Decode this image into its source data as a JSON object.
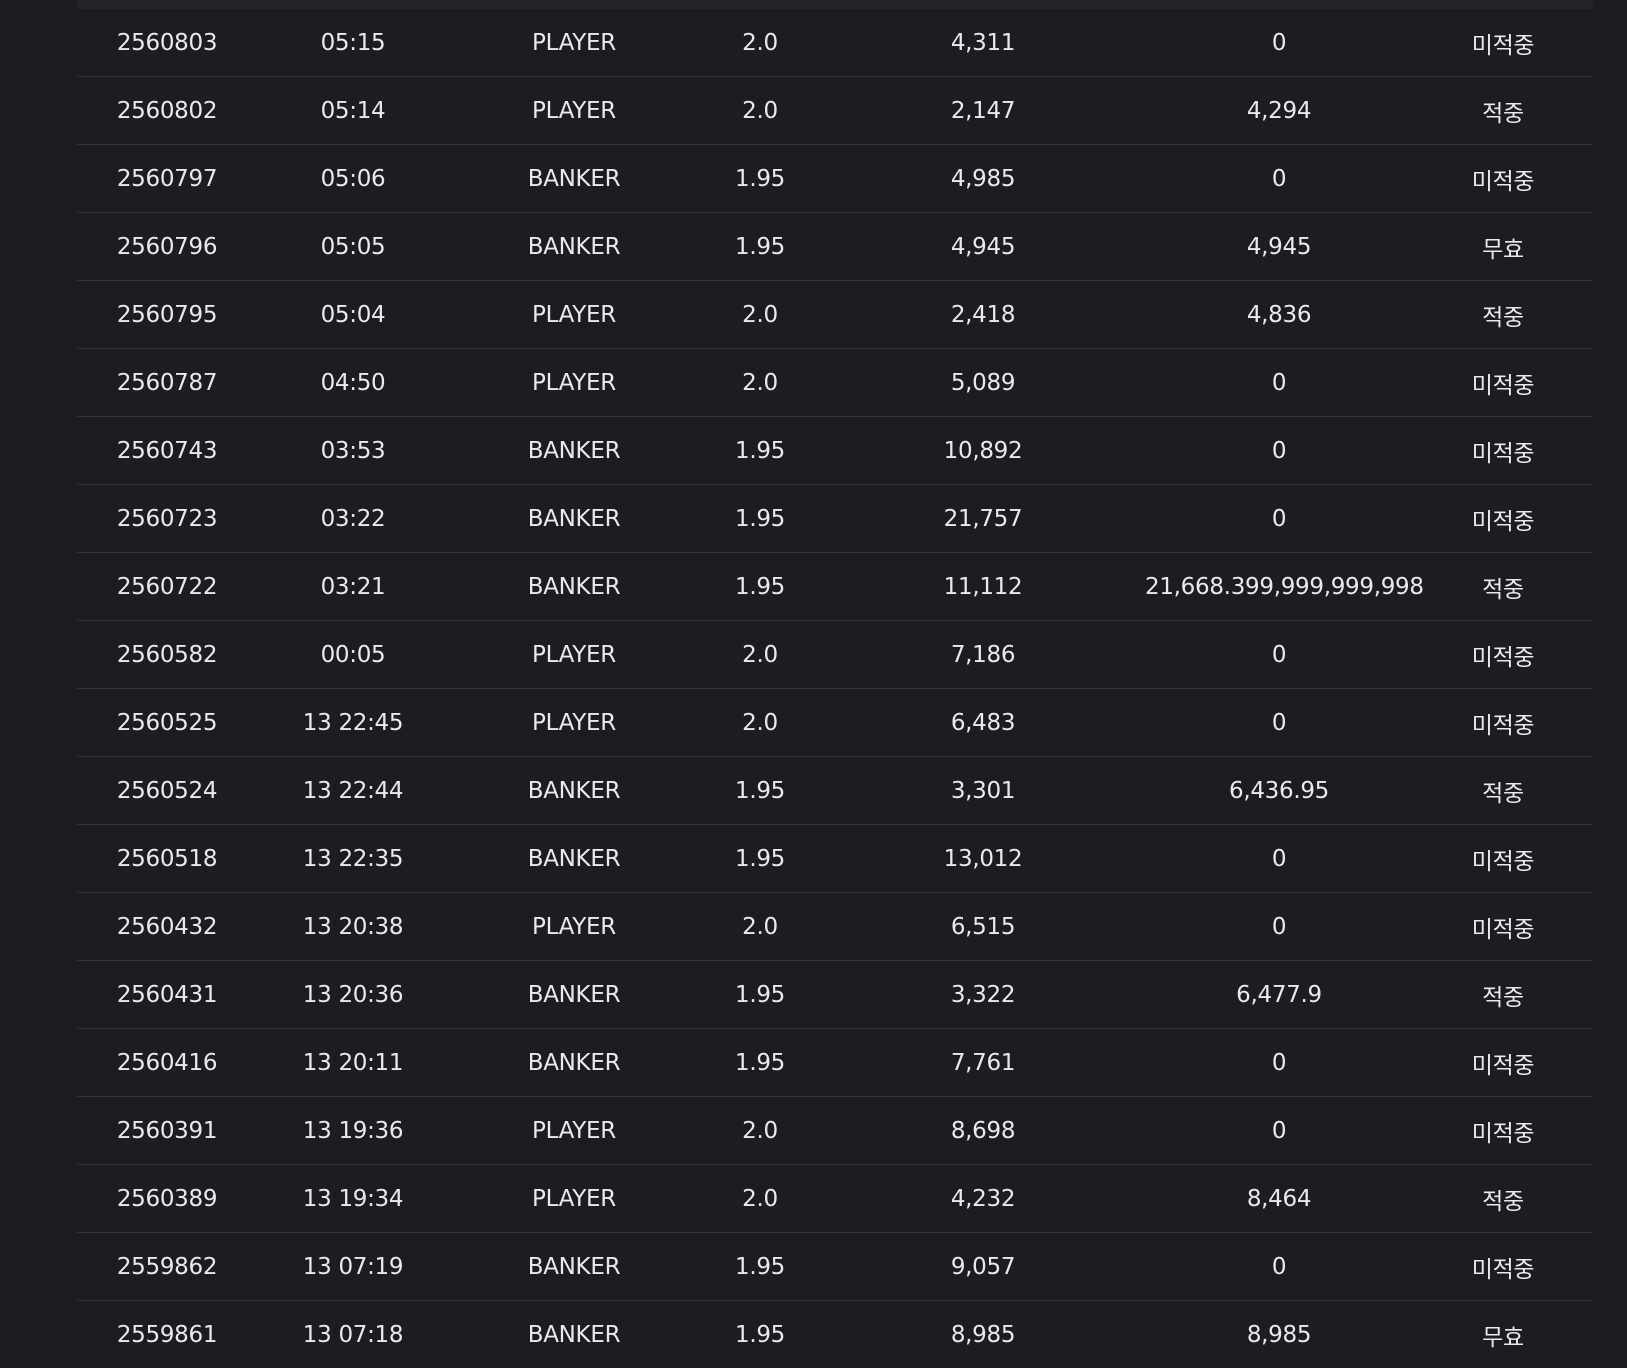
{
  "bet_history": {
    "rows": [
      {
        "id": "2560803",
        "time": "05:15",
        "pick": "PLAYER",
        "odds": "2.0",
        "bet": "4,311",
        "win": "0",
        "result": "미적중"
      },
      {
        "id": "2560802",
        "time": "05:14",
        "pick": "PLAYER",
        "odds": "2.0",
        "bet": "2,147",
        "win": "4,294",
        "result": "적중"
      },
      {
        "id": "2560797",
        "time": "05:06",
        "pick": "BANKER",
        "odds": "1.95",
        "bet": "4,985",
        "win": "0",
        "result": "미적중"
      },
      {
        "id": "2560796",
        "time": "05:05",
        "pick": "BANKER",
        "odds": "1.95",
        "bet": "4,945",
        "win": "4,945",
        "result": "무효"
      },
      {
        "id": "2560795",
        "time": "05:04",
        "pick": "PLAYER",
        "odds": "2.0",
        "bet": "2,418",
        "win": "4,836",
        "result": "적중"
      },
      {
        "id": "2560787",
        "time": "04:50",
        "pick": "PLAYER",
        "odds": "2.0",
        "bet": "5,089",
        "win": "0",
        "result": "미적중"
      },
      {
        "id": "2560743",
        "time": "03:53",
        "pick": "BANKER",
        "odds": "1.95",
        "bet": "10,892",
        "win": "0",
        "result": "미적중"
      },
      {
        "id": "2560723",
        "time": "03:22",
        "pick": "BANKER",
        "odds": "1.95",
        "bet": "21,757",
        "win": "0",
        "result": "미적중"
      },
      {
        "id": "2560722",
        "time": "03:21",
        "pick": "BANKER",
        "odds": "1.95",
        "bet": "11,112",
        "win": "21,668.399,999,999,998",
        "result": "적중"
      },
      {
        "id": "2560582",
        "time": "00:05",
        "pick": "PLAYER",
        "odds": "2.0",
        "bet": "7,186",
        "win": "0",
        "result": "미적중"
      },
      {
        "id": "2560525",
        "time": "13 22:45",
        "pick": "PLAYER",
        "odds": "2.0",
        "bet": "6,483",
        "win": "0",
        "result": "미적중"
      },
      {
        "id": "2560524",
        "time": "13 22:44",
        "pick": "BANKER",
        "odds": "1.95",
        "bet": "3,301",
        "win": "6,436.95",
        "result": "적중"
      },
      {
        "id": "2560518",
        "time": "13 22:35",
        "pick": "BANKER",
        "odds": "1.95",
        "bet": "13,012",
        "win": "0",
        "result": "미적중"
      },
      {
        "id": "2560432",
        "time": "13 20:38",
        "pick": "PLAYER",
        "odds": "2.0",
        "bet": "6,515",
        "win": "0",
        "result": "미적중"
      },
      {
        "id": "2560431",
        "time": "13 20:36",
        "pick": "BANKER",
        "odds": "1.95",
        "bet": "3,322",
        "win": "6,477.9",
        "result": "적중"
      },
      {
        "id": "2560416",
        "time": "13 20:11",
        "pick": "BANKER",
        "odds": "1.95",
        "bet": "7,761",
        "win": "0",
        "result": "미적중"
      },
      {
        "id": "2560391",
        "time": "13 19:36",
        "pick": "PLAYER",
        "odds": "2.0",
        "bet": "8,698",
        "win": "0",
        "result": "미적중"
      },
      {
        "id": "2560389",
        "time": "13 19:34",
        "pick": "PLAYER",
        "odds": "2.0",
        "bet": "4,232",
        "win": "8,464",
        "result": "적중"
      },
      {
        "id": "2559862",
        "time": "13 07:19",
        "pick": "BANKER",
        "odds": "1.95",
        "bet": "9,057",
        "win": "0",
        "result": "미적중"
      },
      {
        "id": "2559861",
        "time": "13 07:18",
        "pick": "BANKER",
        "odds": "1.95",
        "bet": "8,985",
        "win": "8,985",
        "result": "무효"
      }
    ]
  }
}
